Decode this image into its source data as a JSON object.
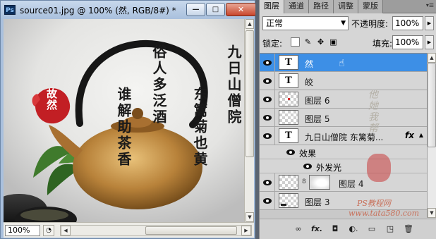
{
  "document": {
    "ps_badge": "Ps",
    "title": "source01.jpg @ 100% (然, RGB/8#) *",
    "zoom": "100%",
    "buttons": {
      "minimize": "—",
      "maximize": "□",
      "close": "✕"
    }
  },
  "canvas": {
    "seal_text": "故然",
    "calligraphy": [
      {
        "text": "九日山僧院"
      },
      {
        "text": "东篱菊也黄"
      },
      {
        "text": "俗人多泛酒"
      },
      {
        "text": "谁解助茶香"
      }
    ]
  },
  "panel": {
    "tabs": [
      "图层",
      "通道",
      "路径",
      "调整",
      "蒙版"
    ],
    "active_tab": "图层",
    "blend_mode": "正常",
    "opacity_label": "不透明度:",
    "opacity_value": "100%",
    "lock_label": "锁定:",
    "fill_label": "填充:",
    "fill_value": "100%",
    "layers": [
      {
        "name": "然",
        "kind": "text",
        "thumb": "T",
        "selected": true
      },
      {
        "name": "皎",
        "kind": "text",
        "thumb": "T",
        "selected": false
      },
      {
        "name": "图层 6",
        "kind": "raster",
        "selected": false
      },
      {
        "name": "图层 5",
        "kind": "raster",
        "selected": false
      },
      {
        "name": "九日山僧院    东篱菊...",
        "kind": "text",
        "thumb": "T",
        "fx": "fx",
        "selected": false
      },
      {
        "name": "图层 4",
        "kind": "raster-mask",
        "selected": false
      },
      {
        "name": "图层 3",
        "kind": "raster",
        "selected": false
      }
    ],
    "effects": {
      "header": "效果",
      "items": [
        "外发光"
      ]
    },
    "bottom_icons": [
      "link-icon",
      "fx-icon",
      "mask-icon",
      "adjustment-icon",
      "group-icon",
      "new-layer-icon",
      "trash-icon"
    ],
    "bottom_labels": [
      "∞",
      "fx.",
      "◘",
      "◐.",
      "▭",
      "◳",
      "🗑"
    ]
  },
  "watermark": {
    "side_text": "他她我帮",
    "site_text": "PS教程网",
    "site_url": "www.tata580.com"
  },
  "colors": {
    "selection": "#3d8fe6",
    "panel_bg": "#d6d6d6",
    "window_frame": "#a9c0dd"
  }
}
